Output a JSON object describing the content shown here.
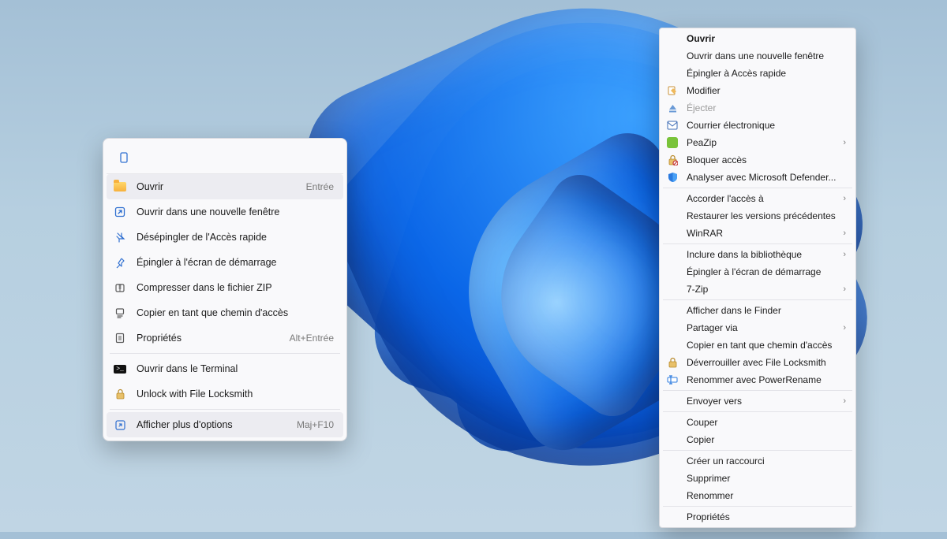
{
  "menu1": {
    "toolbar": {
      "copy_path_icon": "copy-path-icon"
    },
    "items": [
      {
        "icon": "folder-icon",
        "label": "Ouvrir",
        "accel": "Entrée",
        "hover": true
      },
      {
        "icon": "open-external-icon",
        "label": "Ouvrir dans une nouvelle fenêtre"
      },
      {
        "icon": "unpin-icon",
        "label": "Désépingler de l'Accès rapide"
      },
      {
        "icon": "pin-icon",
        "label": "Épingler à l'écran de démarrage"
      },
      {
        "icon": "zip-icon",
        "label": "Compresser dans le fichier ZIP"
      },
      {
        "icon": "copy-path-icon",
        "label": "Copier en tant que chemin d'accès"
      },
      {
        "icon": "properties-icon",
        "label": "Propriétés",
        "accel": "Alt+Entrée"
      },
      {
        "sep": true
      },
      {
        "icon": "terminal-icon",
        "label": "Ouvrir dans le Terminal"
      },
      {
        "icon": "lock-icon",
        "label": "Unlock with File Locksmith"
      },
      {
        "sep": true
      },
      {
        "icon": "more-icon",
        "label": "Afficher plus d'options",
        "accel": "Maj+F10",
        "hover": true
      }
    ]
  },
  "menu2": {
    "groups": [
      [
        {
          "label": "Ouvrir",
          "bold": true
        },
        {
          "label": "Ouvrir dans une nouvelle fenêtre"
        },
        {
          "label": "Épingler à Accès rapide"
        },
        {
          "icon": "edit-icon",
          "label": "Modifier"
        },
        {
          "icon": "eject-icon",
          "label": "Éjecter",
          "disabled": true
        },
        {
          "icon": "mail-icon",
          "label": "Courrier électronique"
        },
        {
          "icon": "peazip-icon",
          "label": "PeaZip",
          "submenu": true
        },
        {
          "icon": "block-icon",
          "label": "Bloquer accès"
        },
        {
          "icon": "shield-icon",
          "label": "Analyser avec Microsoft Defender..."
        }
      ],
      [
        {
          "label": "Accorder l'accès à",
          "submenu": true
        },
        {
          "label": "Restaurer les versions précédentes"
        },
        {
          "label": "WinRAR",
          "submenu": true
        }
      ],
      [
        {
          "label": "Inclure dans la bibliothèque",
          "submenu": true
        },
        {
          "label": "Épingler à l'écran de démarrage"
        },
        {
          "label": "7-Zip",
          "submenu": true
        }
      ],
      [
        {
          "label": "Afficher dans le Finder"
        },
        {
          "label": "Partager via",
          "submenu": true
        },
        {
          "label": "Copier en tant que chemin d'accès"
        },
        {
          "icon": "unlock-icon",
          "label": "Déverrouiller avec File Locksmith"
        },
        {
          "icon": "rename-icon",
          "label": "Renommer avec PowerRename"
        }
      ],
      [
        {
          "label": "Envoyer vers",
          "submenu": true
        }
      ],
      [
        {
          "label": "Couper"
        },
        {
          "label": "Copier"
        }
      ],
      [
        {
          "label": "Créer un raccourci"
        },
        {
          "label": "Supprimer"
        },
        {
          "label": "Renommer"
        }
      ],
      [
        {
          "label": "Propriétés"
        }
      ]
    ]
  }
}
